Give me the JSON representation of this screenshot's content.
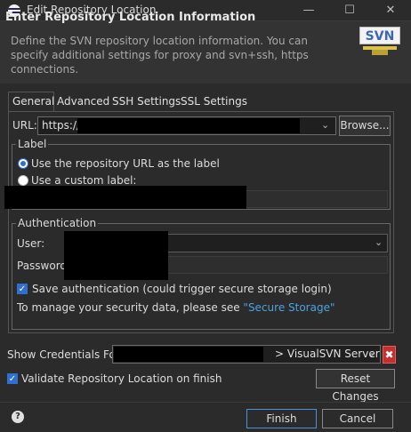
{
  "window": {
    "title": "Edit Repository Location"
  },
  "header": {
    "title": "Enter Repository Location Information",
    "description": "Define the SVN repository location information. You can specify additional settings for proxy and svn+ssh, https connections.",
    "logo_text": "SVN"
  },
  "tabs": [
    {
      "label": "General",
      "selected": true
    },
    {
      "label": "Advanced",
      "selected": false
    },
    {
      "label": "SSH Settings",
      "selected": false
    },
    {
      "label": "SSL Settings",
      "selected": false
    }
  ],
  "general": {
    "url_label": "URL:",
    "url_value": "https://",
    "browse_label": "Browse...",
    "label_group": {
      "title": "Label",
      "option_url": "Use the repository URL as the label",
      "option_custom": "Use a custom label:"
    },
    "auth_group": {
      "title": "Authentication",
      "user_label": "User:",
      "password_label": "Password:",
      "save_auth_label": "Save authentication (could trigger secure storage login)",
      "manage_text": "To manage your security data, please see ",
      "manage_link": "\"Secure Storage\""
    }
  },
  "bottom": {
    "show_cred_label": "Show Credentials For:",
    "show_cred_value": "> VisualSVN Server",
    "delete_symbol": "✖",
    "validate_label": "Validate Repository Location on finish",
    "reset_label": "Reset Changes"
  },
  "footer": {
    "help_symbol": "?",
    "finish_label": "Finish",
    "cancel_label": "Cancel"
  },
  "colors": {
    "background": "#2b2b2b",
    "accent": "#2f6fd0",
    "link": "#4aa3df",
    "delete": "#c62f2f"
  }
}
